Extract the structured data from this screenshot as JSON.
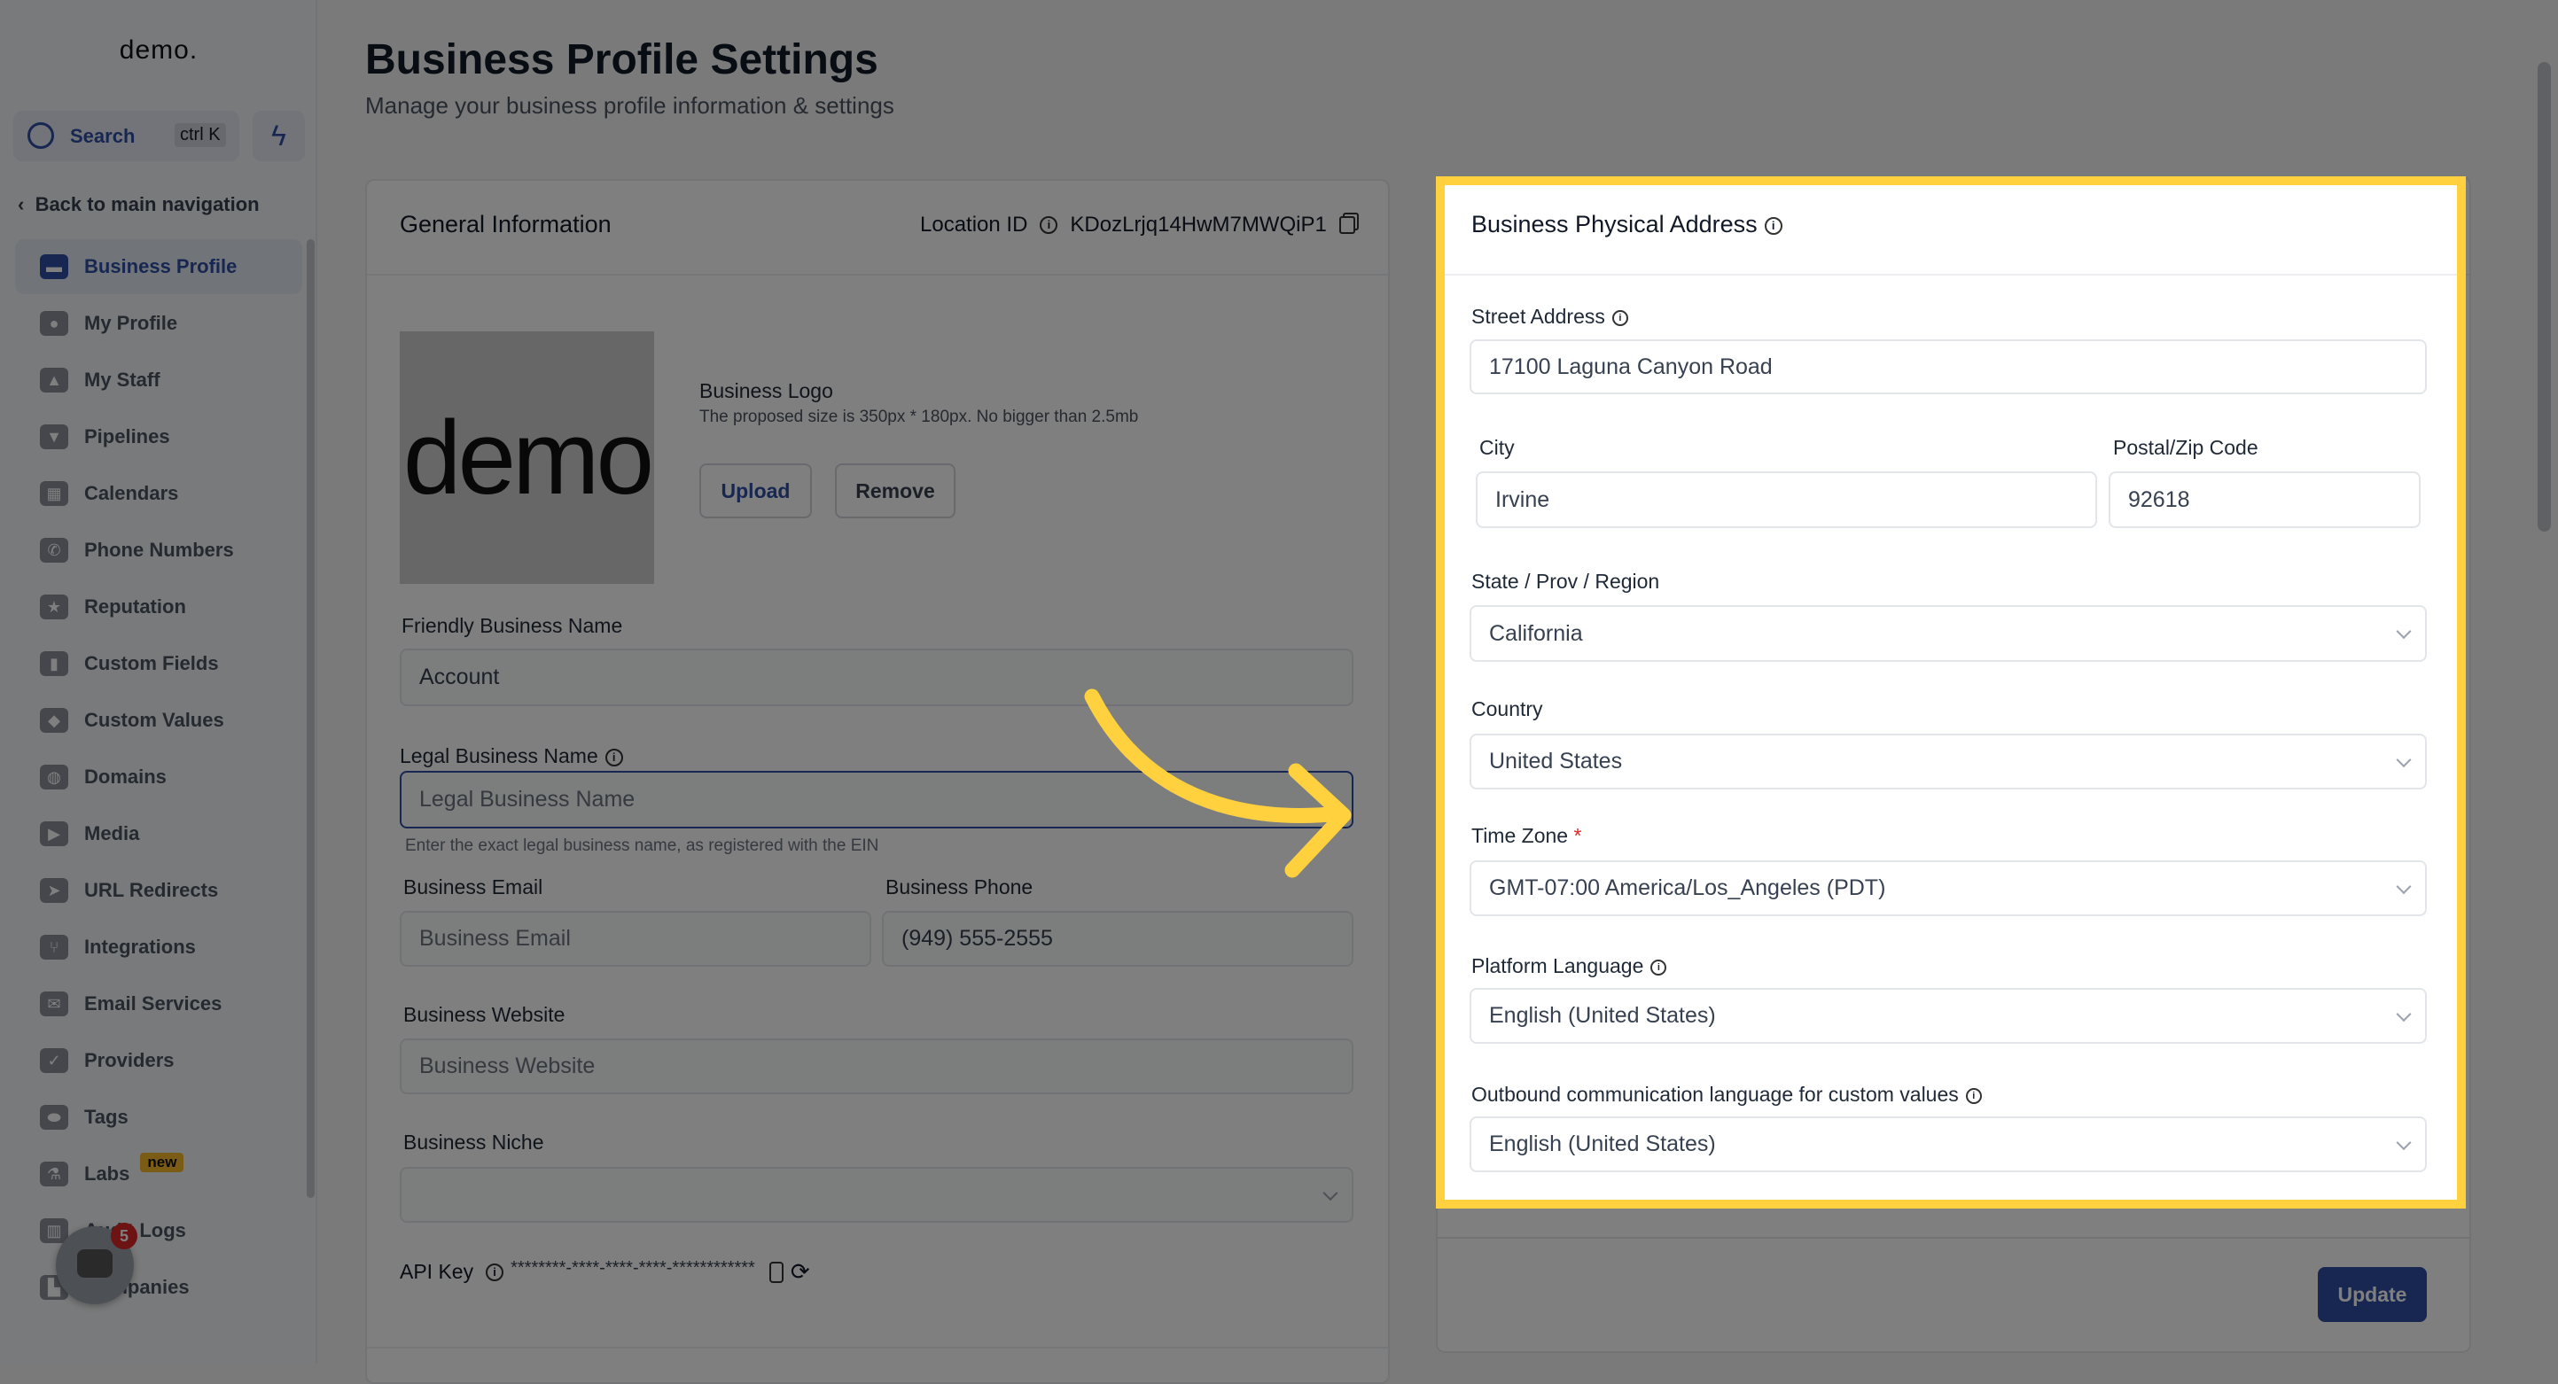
{
  "sidebar": {
    "logo": "demo.",
    "search_label": "Search",
    "search_shortcut": "ctrl K",
    "back_label": "Back to main navigation",
    "items": [
      {
        "label": "Business Profile",
        "icon": "briefcase-icon",
        "glyph": "▬",
        "active": true
      },
      {
        "label": "My Profile",
        "icon": "user-circle-icon",
        "glyph": "●"
      },
      {
        "label": "My Staff",
        "icon": "user-icon",
        "glyph": "▲"
      },
      {
        "label": "Pipelines",
        "icon": "filter-icon",
        "glyph": "▼"
      },
      {
        "label": "Calendars",
        "icon": "calendar-icon",
        "glyph": "▦"
      },
      {
        "label": "Phone Numbers",
        "icon": "phone-icon",
        "glyph": "✆"
      },
      {
        "label": "Reputation",
        "icon": "star-icon",
        "glyph": "★"
      },
      {
        "label": "Custom Fields",
        "icon": "fields-icon",
        "glyph": "▮"
      },
      {
        "label": "Custom Values",
        "icon": "diamond-icon",
        "glyph": "◆"
      },
      {
        "label": "Domains",
        "icon": "globe-icon",
        "glyph": "◍"
      },
      {
        "label": "Media",
        "icon": "video-icon",
        "glyph": "▶"
      },
      {
        "label": "URL Redirects",
        "icon": "redirect-icon",
        "glyph": "➤"
      },
      {
        "label": "Integrations",
        "icon": "integrations-icon",
        "glyph": "⑂"
      },
      {
        "label": "Email Services",
        "icon": "email-icon",
        "glyph": "✉"
      },
      {
        "label": "Providers",
        "icon": "clipboard-icon",
        "glyph": "✓"
      },
      {
        "label": "Tags",
        "icon": "tag-icon",
        "glyph": "⬬"
      },
      {
        "label": "Labs",
        "icon": "flask-icon",
        "glyph": "⚗",
        "badge": "new"
      },
      {
        "label": "Audit Logs",
        "icon": "bar-chart-icon",
        "glyph": "▥"
      },
      {
        "label": "Companies",
        "icon": "building-icon",
        "glyph": "▙"
      }
    ]
  },
  "chat_widget": {
    "badge_count": "5"
  },
  "header": {
    "title": "Business Profile Settings",
    "subtitle": "Manage your business profile information & settings"
  },
  "general": {
    "title": "General Information",
    "location_id_label": "Location ID",
    "location_id": "KDozLrjq14HwM7MWQiP1",
    "logo_image_text": "demo",
    "logo_label": "Business Logo",
    "logo_hint": "The proposed size is 350px * 180px. No bigger than 2.5mb",
    "upload_label": "Upload",
    "remove_label": "Remove",
    "friendly_name_label": "Friendly Business Name",
    "friendly_name_value": "Account",
    "legal_name_label": "Legal Business Name",
    "legal_name_placeholder": "Legal Business Name",
    "legal_name_hint": "Enter the exact legal business name, as registered with the EIN",
    "email_label": "Business Email",
    "email_placeholder": "Business Email",
    "phone_label": "Business Phone",
    "phone_value": "(949) 555-2555",
    "website_label": "Business Website",
    "website_placeholder": "Business Website",
    "niche_label": "Business Niche",
    "niche_value": "",
    "api_key_label": "API Key",
    "api_key_value": "********-****-****-****-************"
  },
  "address": {
    "title": "Business Physical Address",
    "street_label": "Street Address",
    "street_value": "17100 Laguna Canyon Road",
    "city_label": "City",
    "city_value": "Irvine",
    "zip_label": "Postal/Zip Code",
    "zip_value": "92618",
    "state_label": "State / Prov / Region",
    "state_value": "California",
    "country_label": "Country",
    "country_value": "United States",
    "timezone_label": "Time Zone",
    "timezone_required": "*",
    "timezone_value": "GMT-07:00 America/Los_Angeles (PDT)",
    "platform_language_label": "Platform Language",
    "platform_language_value": "English (United States)",
    "outbound_language_label": "Outbound communication language for custom values",
    "outbound_language_value": "English (United States)",
    "update_label": "Update"
  },
  "colors": {
    "highlight": "#ffd13f",
    "primary": "#2e4ea3",
    "arrow": "#ffd13f"
  }
}
